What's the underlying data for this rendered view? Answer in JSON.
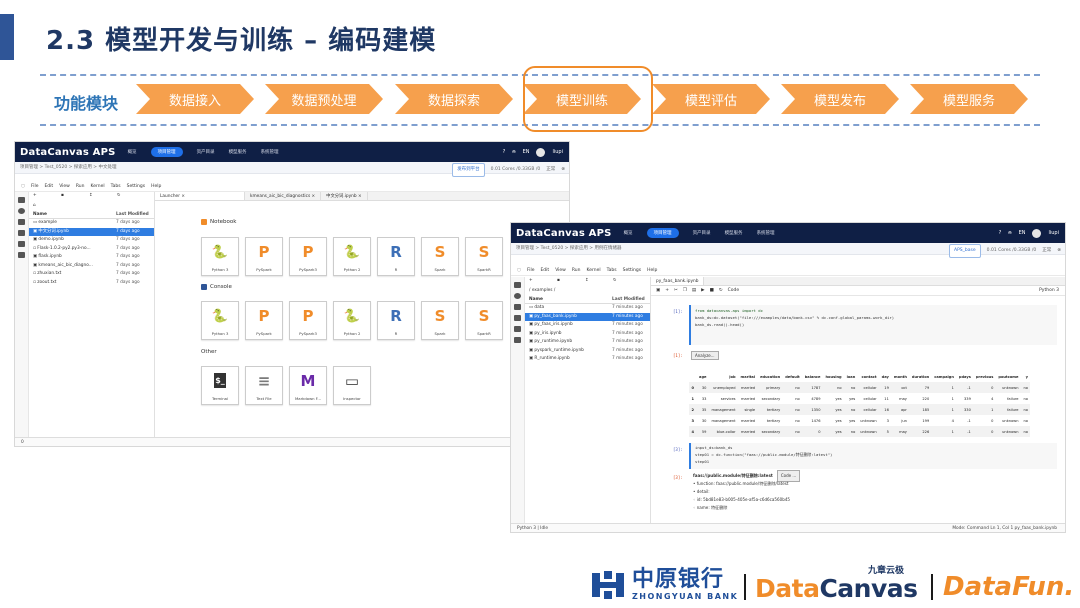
{
  "slide": {
    "title": "2.3 模型开发与训练 – 编码建模",
    "flow_label": "功能模块",
    "flow_steps": [
      "数据接入",
      "数据预处理",
      "数据探索",
      "模型训练",
      "模型评估",
      "模型发布",
      "模型服务"
    ],
    "highlighted_step": "模型训练"
  },
  "colors": {
    "accent_orange": "#f6a04d",
    "nav_dark": "#0f1f45",
    "blue": "#2f7de1",
    "title_blue": "#1f3864"
  },
  "win1": {
    "brand": "DataCanvas APS",
    "nav": [
      "概览",
      "项目管理",
      "资产目录",
      "模型服务",
      "系统管理"
    ],
    "nav_active": "项目管理",
    "nav_right": {
      "lang": "EN",
      "user": "liupi"
    },
    "crumb": "项目管理 > Test_0520 > 探索应用 > 中文处理",
    "publish_label": "发布到平台",
    "cores": "0.01 Cores /0.33GB /0",
    "status": "正常",
    "menu": [
      "File",
      "Edit",
      "View",
      "Run",
      "Kernel",
      "Tabs",
      "Settings",
      "Help"
    ],
    "file_header": {
      "name": "Name",
      "modified": "Last Modified"
    },
    "files": [
      {
        "name": "example",
        "date": "7 days ago"
      },
      {
        "name": "中文分词.ipynb",
        "date": "7 days ago"
      },
      {
        "name": "demo.ipynb",
        "date": "7 days ago"
      },
      {
        "name": "Flask-1.0.2-py2.py3-no...",
        "date": "7 days ago"
      },
      {
        "name": "flask.ipynb",
        "date": "7 days ago"
      },
      {
        "name": "kmeans_aic_bic_diagno...",
        "date": "7 days ago"
      },
      {
        "name": "zhuxian.txt",
        "date": "7 days ago"
      },
      {
        "name": "zoout.txt",
        "date": "7 days ago"
      }
    ],
    "tabs": [
      "Launcher",
      "kmeans_aic_bic_diagnostics",
      "中文分词.ipynb"
    ],
    "sections": {
      "notebook": "Notebook",
      "console": "Console",
      "other": "Other"
    },
    "kernels": [
      {
        "label": "Python 3",
        "glyph": "🐍"
      },
      {
        "label": "PySpark",
        "glyph": "P"
      },
      {
        "label": "PySpark3",
        "glyph": "P"
      },
      {
        "label": "Python 2",
        "glyph": "🐍"
      },
      {
        "label": "R",
        "glyph": "R"
      },
      {
        "label": "Spark",
        "glyph": "S"
      },
      {
        "label": "SparkR",
        "glyph": "S"
      }
    ],
    "others": [
      {
        "label": "Terminal",
        "glyph": "$_"
      },
      {
        "label": "Text File",
        "glyph": "≡"
      },
      {
        "label": "Markdown F...",
        "glyph": "M"
      },
      {
        "label": "Inspector",
        "glyph": "▭"
      }
    ],
    "statusbar": "0"
  },
  "win2": {
    "brand": "DataCanvas APS",
    "nav": [
      "概览",
      "项目管理",
      "资产目录",
      "模型服务",
      "系统管理"
    ],
    "nav_active": "项目管理",
    "nav_right": {
      "lang": "EN",
      "user": "liupi"
    },
    "crumb": "项目管理 > Test_0520 > 探索应用 > 用例在情绪器",
    "aps_base": "APS_base",
    "cores": "0.01 Cores /0.33GB /0",
    "status": "正常",
    "menu": [
      "File",
      "Edit",
      "View",
      "Run",
      "Kernel",
      "Tabs",
      "Settings",
      "Help"
    ],
    "path": "/ examples /",
    "file_header": {
      "name": "Name",
      "modified": "Last Modified"
    },
    "files": [
      {
        "name": "data",
        "date": "7 minutes ago"
      },
      {
        "name": "py_faas_bank.ipynb",
        "date": "7 minutes ago"
      },
      {
        "name": "py_faas_iris.ipynb",
        "date": "7 minutes ago"
      },
      {
        "name": "py_iris.ipynb",
        "date": "7 minutes ago"
      },
      {
        "name": "py_runtime.ipynb",
        "date": "7 minutes ago"
      },
      {
        "name": "pyspark_runtime.ipynb",
        "date": "7 minutes ago"
      },
      {
        "name": "R_runtime.ipynb",
        "date": "7 minutes ago"
      }
    ],
    "tab": "py_faas_bank.ipynb",
    "celltype": "Code",
    "kernel": "Python 3",
    "cell1_prompt": "[1]:",
    "cell1_lines": [
      "from datacanvas.aps import dc",
      "bank_ds=dc.dataset(\"file:///examples/data/bank.csv\" % dc.conf.global_params.work_dir)",
      "bank_ds.read().head()"
    ],
    "out1_prompt": "[1]:",
    "analyze_button": "Analyze...",
    "df_columns": [
      "",
      "age",
      "job",
      "marital",
      "education",
      "default",
      "balance",
      "housing",
      "loan",
      "contact",
      "day",
      "month",
      "duration",
      "campaign",
      "pdays",
      "previous",
      "poutcome",
      "y"
    ],
    "df_rows": [
      [
        "0",
        "30",
        "unemployed",
        "married",
        "primary",
        "no",
        "1787",
        "no",
        "no",
        "cellular",
        "19",
        "oct",
        "79",
        "1",
        "-1",
        "0",
        "unknown",
        "no"
      ],
      [
        "1",
        "33",
        "services",
        "married",
        "secondary",
        "no",
        "4789",
        "yes",
        "yes",
        "cellular",
        "11",
        "may",
        "220",
        "1",
        "339",
        "4",
        "failure",
        "no"
      ],
      [
        "2",
        "35",
        "management",
        "single",
        "tertiary",
        "no",
        "1350",
        "yes",
        "no",
        "cellular",
        "16",
        "apr",
        "185",
        "1",
        "330",
        "1",
        "failure",
        "no"
      ],
      [
        "3",
        "30",
        "management",
        "married",
        "tertiary",
        "no",
        "1476",
        "yes",
        "yes",
        "unknown",
        "3",
        "jun",
        "199",
        "4",
        "-1",
        "0",
        "unknown",
        "no"
      ],
      [
        "4",
        "59",
        "blue-collar",
        "married",
        "secondary",
        "no",
        "0",
        "yes",
        "no",
        "unknown",
        "5",
        "may",
        "226",
        "1",
        "-1",
        "0",
        "unknown",
        "no"
      ]
    ],
    "cell2_prompt": "[3]:",
    "cell2_lines": [
      "input_ds=bank_ds",
      "step01 = dc.function(\"faas://public.module/特征删除:latest\")",
      "step01"
    ],
    "out2_prompt": "[3]:",
    "out2_header": "faas://public.module/特征删除:latest",
    "code_button": "Code ...",
    "out2_lines": [
      "• function: faas://public.module/特征删除/latest",
      "• detail:",
      "    ◦ id: 5bd81e83-b005-405e-af5a-c6d6ca560b45",
      "    ◦ name: 特征删除"
    ],
    "status_left": "Python 3 | Idle",
    "status_right": "Mode: Command    Ln 1, Col 1   py_faas_bank.ipynb"
  },
  "logos": {
    "zy_cn": "中原银行",
    "zy_en": "ZHONGYUAN BANK",
    "dc_top": "九章云极",
    "dc_a": "Data",
    "dc_b": "Canvas",
    "df": "DataFun."
  }
}
